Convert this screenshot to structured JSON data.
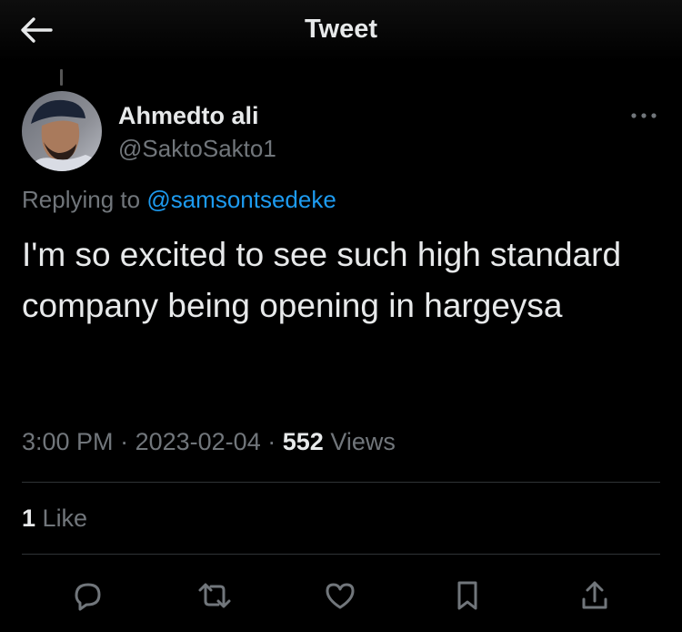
{
  "header": {
    "title": "Tweet"
  },
  "author": {
    "display_name": "Ahmedto ali",
    "handle": "@SaktoSakto1"
  },
  "reply_context": {
    "prefix": "Replying to",
    "mention": "@samsontsedeke"
  },
  "tweet": {
    "text": "I'm so excited to see such high standard company being opening in hargeysa",
    "time": "3:00 PM",
    "date": "2023-02-04",
    "views_count": "552",
    "views_label": "Views",
    "separator": "·"
  },
  "engagement": {
    "likes_count": "1",
    "likes_label": "Like"
  },
  "icons": {
    "back": "arrow-left-icon",
    "more": "more-horizontal-icon",
    "reply": "reply-bubble-icon",
    "retweet": "retweet-icon",
    "like": "heart-icon",
    "bookmark": "bookmark-icon",
    "share": "share-icon"
  },
  "colors": {
    "background": "#000000",
    "text": "#e7e9ea",
    "secondary": "#71767b",
    "accent": "#1d9bf0",
    "divider": "#2f3336"
  }
}
